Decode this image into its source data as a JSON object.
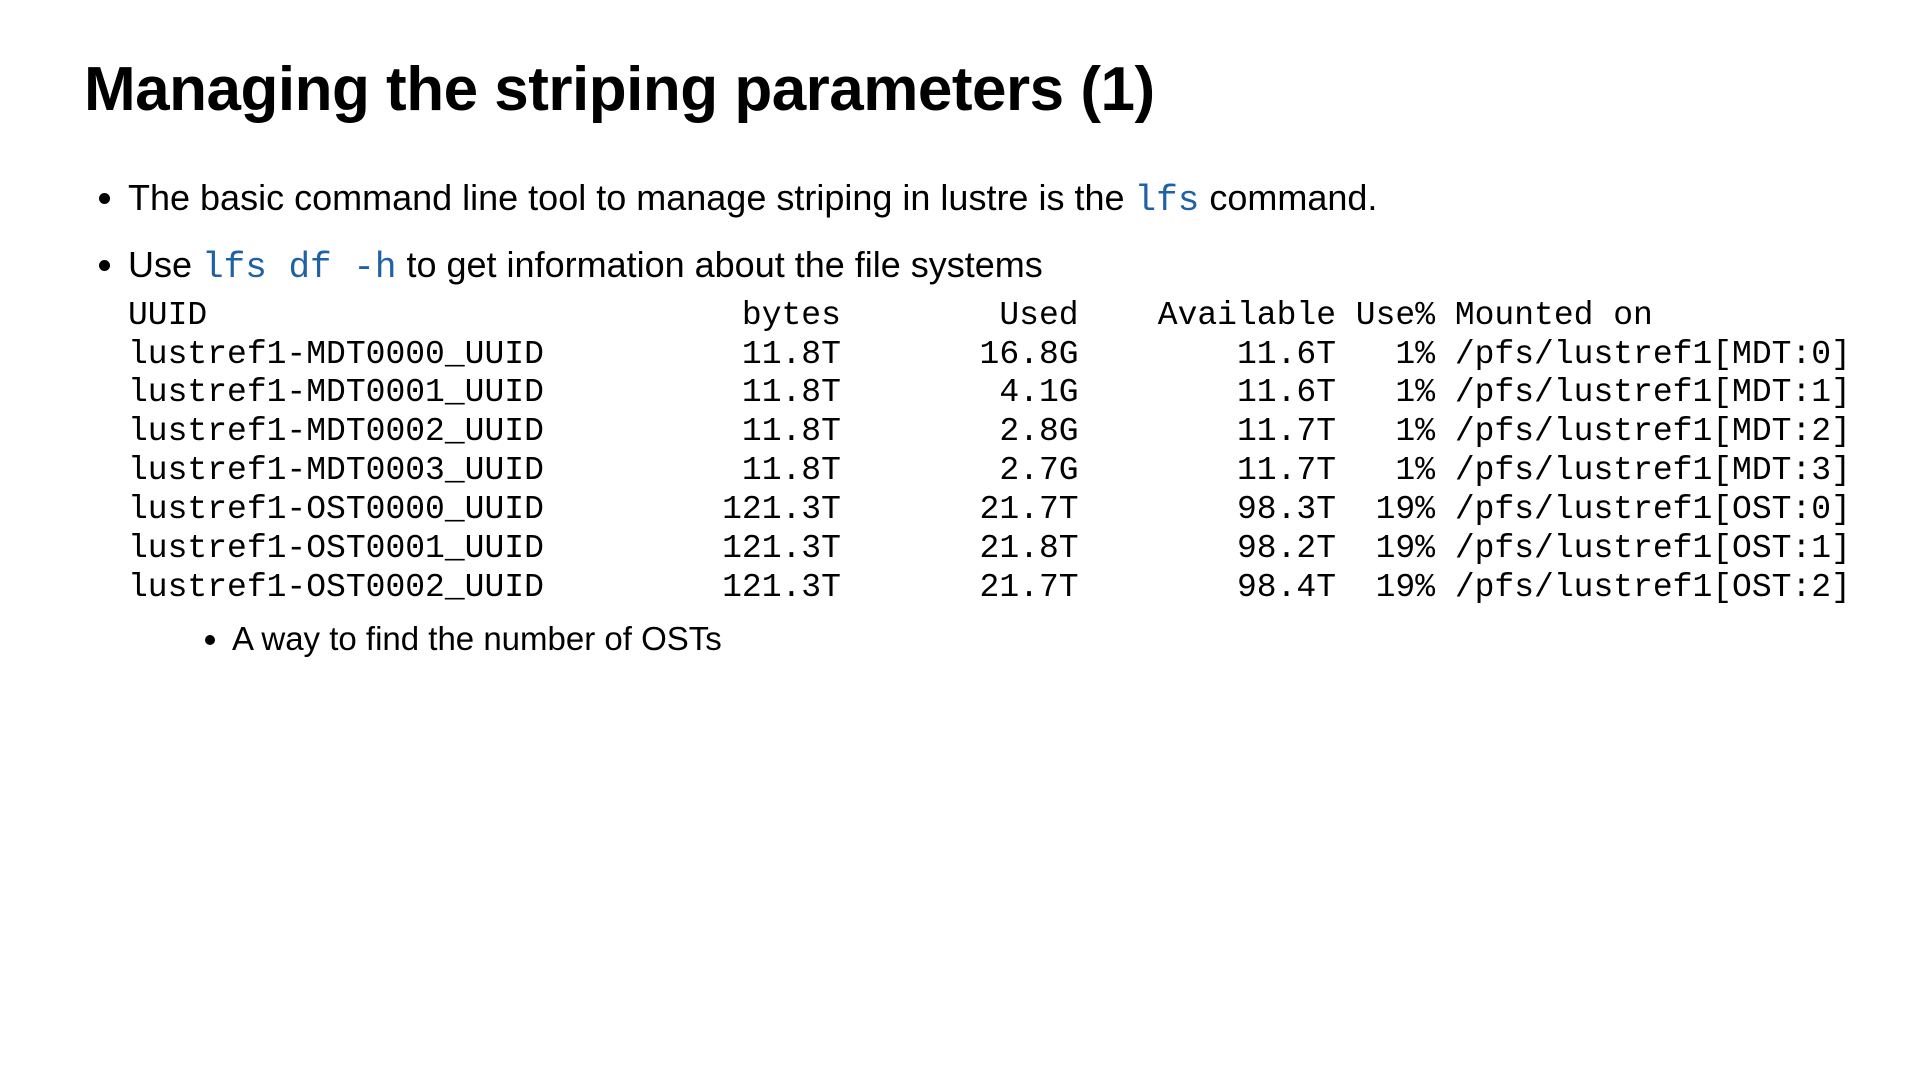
{
  "title": "Managing the striping parameters (1)",
  "bullets": {
    "b1_pre": "The basic command line tool to manage striping in lustre is the ",
    "b1_code": "lfs",
    "b1_post": " command.",
    "b2_pre": "Use ",
    "b2_code": "lfs df -h",
    "b2_post": " to get information about the file systems"
  },
  "df_header": {
    "uuid": "UUID",
    "bytes": "bytes",
    "used": "Used",
    "avail": "Available",
    "usep": "Use%",
    "mounted": "Mounted on"
  },
  "df_rows": [
    {
      "uuid": "lustref1-MDT0000_UUID",
      "bytes": "11.8T",
      "used": "16.8G",
      "avail": "11.6T",
      "usep": "1%",
      "mounted": "/pfs/lustref1[MDT:0]"
    },
    {
      "uuid": "lustref1-MDT0001_UUID",
      "bytes": "11.8T",
      "used": "4.1G",
      "avail": "11.6T",
      "usep": "1%",
      "mounted": "/pfs/lustref1[MDT:1]"
    },
    {
      "uuid": "lustref1-MDT0002_UUID",
      "bytes": "11.8T",
      "used": "2.8G",
      "avail": "11.7T",
      "usep": "1%",
      "mounted": "/pfs/lustref1[MDT:2]"
    },
    {
      "uuid": "lustref1-MDT0003_UUID",
      "bytes": "11.8T",
      "used": "2.7G",
      "avail": "11.7T",
      "usep": "1%",
      "mounted": "/pfs/lustref1[MDT:3]"
    },
    {
      "uuid": "lustref1-OST0000_UUID",
      "bytes": "121.3T",
      "used": "21.7T",
      "avail": "98.3T",
      "usep": "19%",
      "mounted": "/pfs/lustref1[OST:0]"
    },
    {
      "uuid": "lustref1-OST0001_UUID",
      "bytes": "121.3T",
      "used": "21.8T",
      "avail": "98.2T",
      "usep": "19%",
      "mounted": "/pfs/lustref1[OST:1]"
    },
    {
      "uuid": "lustref1-OST0002_UUID",
      "bytes": "121.3T",
      "used": "21.7T",
      "avail": "98.4T",
      "usep": "19%",
      "mounted": "/pfs/lustref1[OST:2]"
    }
  ],
  "sub_bullet": "A way to find the number of OSTs"
}
